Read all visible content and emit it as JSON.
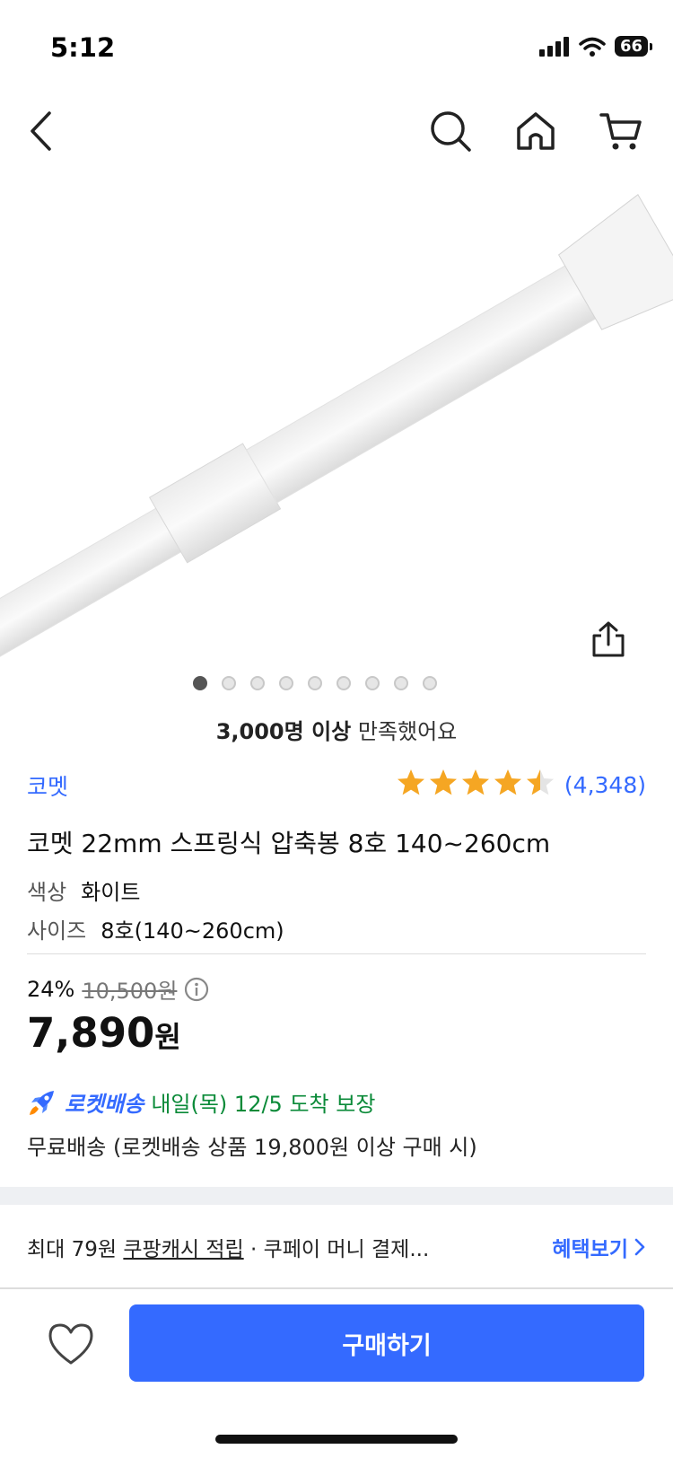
{
  "status_bar": {
    "time": "5:12",
    "battery": "66"
  },
  "navigation": {
    "icons": [
      "back-icon",
      "search-icon",
      "home-icon",
      "cart-icon"
    ]
  },
  "carousel": {
    "total": 9,
    "active_index": 0
  },
  "satisfaction": {
    "bold": "3,000명 이상",
    "rest": " 만족했어요"
  },
  "product": {
    "brand": "코멧",
    "rating": {
      "stars": 4.5,
      "count": "(4,348)"
    },
    "title": "코멧 22mm 스프링식 압축봉 8호 140~260cm",
    "options": [
      {
        "key": "색상",
        "value": "화이트"
      },
      {
        "key": "사이즈",
        "value": "8호(140~260cm)"
      }
    ]
  },
  "pricing": {
    "discount": "24%",
    "original": "10,500원",
    "price": "7,890",
    "currency": "원"
  },
  "delivery": {
    "rocket_label": "로켓배송",
    "arrival": "내일(목) 12/5 도착 보장",
    "free_shipping": "무료배송 (로켓배송 상품 19,800원 이상 구매 시)"
  },
  "benefit": {
    "prefix": "최대 79원 ",
    "underlined": "쿠팡캐시 적립",
    "suffix": " · 쿠페이 머니 결제...",
    "link": "혜택보기"
  },
  "actions": {
    "buy": "구매하기"
  },
  "colors": {
    "accent": "#346aff",
    "star": "#f5a623",
    "delivery": "#0a8a38"
  }
}
